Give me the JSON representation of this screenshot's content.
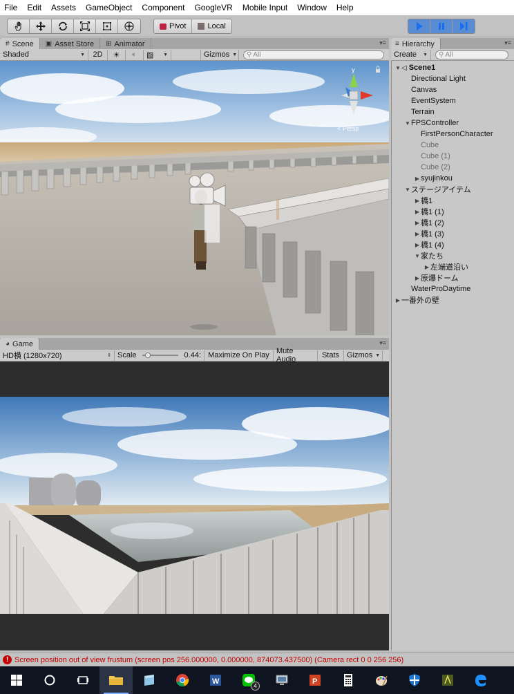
{
  "menu": [
    "File",
    "Edit",
    "Assets",
    "GameObject",
    "Component",
    "GoogleVR",
    "Mobile Input",
    "Window",
    "Help"
  ],
  "toolbar": {
    "pivot_label": "Pivot",
    "local_label": "Local"
  },
  "scene_tabs": {
    "scene": "Scene",
    "asset_store": "Asset Store",
    "animator": "Animator"
  },
  "scene_controls": {
    "shading": "Shaded",
    "mode_2d": "2D",
    "gizmos": "Gizmos",
    "search_placeholder": "All"
  },
  "gizmo": {
    "y_axis": "y",
    "view_label": "< Persp"
  },
  "hierarchy": {
    "tab": "Hierarchy",
    "create": "Create",
    "search_placeholder": "All",
    "items": [
      {
        "label": "Scene1",
        "tri": "▼",
        "indent": 0,
        "style": "bold"
      },
      {
        "label": "Directional Light",
        "tri": "",
        "indent": 1,
        "style": ""
      },
      {
        "label": "Canvas",
        "tri": "",
        "indent": 1,
        "style": ""
      },
      {
        "label": "EventSystem",
        "tri": "",
        "indent": 1,
        "style": ""
      },
      {
        "label": "Terrain",
        "tri": "",
        "indent": 1,
        "style": ""
      },
      {
        "label": "FPSController",
        "tri": "▼",
        "indent": 1,
        "style": ""
      },
      {
        "label": "FirstPersonCharacter",
        "tri": "",
        "indent": 2,
        "style": ""
      },
      {
        "label": "Cube",
        "tri": "",
        "indent": 2,
        "style": "dim"
      },
      {
        "label": "Cube (1)",
        "tri": "",
        "indent": 2,
        "style": "dim"
      },
      {
        "label": "Cube (2)",
        "tri": "",
        "indent": 2,
        "style": "dim"
      },
      {
        "label": "syujinkou",
        "tri": "▶",
        "indent": 2,
        "style": ""
      },
      {
        "label": "ステージアイテム",
        "tri": "▼",
        "indent": 1,
        "style": ""
      },
      {
        "label": "橋1",
        "tri": "▶",
        "indent": 2,
        "style": ""
      },
      {
        "label": "橋1 (1)",
        "tri": "▶",
        "indent": 2,
        "style": ""
      },
      {
        "label": "橋1 (2)",
        "tri": "▶",
        "indent": 2,
        "style": ""
      },
      {
        "label": "橋1 (3)",
        "tri": "▶",
        "indent": 2,
        "style": ""
      },
      {
        "label": "橋1 (4)",
        "tri": "▶",
        "indent": 2,
        "style": ""
      },
      {
        "label": "家たち",
        "tri": "▼",
        "indent": 2,
        "style": ""
      },
      {
        "label": "左端道沿い",
        "tri": "▶",
        "indent": 3,
        "style": ""
      },
      {
        "label": "原爆ドーム",
        "tri": "▶",
        "indent": 2,
        "style": ""
      },
      {
        "label": "WaterProDaytime",
        "tri": "",
        "indent": 1,
        "style": ""
      },
      {
        "label": "一番外の壁",
        "tri": "▶",
        "indent": 0,
        "style": ""
      }
    ]
  },
  "game_tab": {
    "title": "Game",
    "resolution": "HD横 (1280x720)",
    "scale_label": "Scale",
    "scale_value": "0.44:",
    "scale_fraction": 0.08,
    "maximize": "Maximize On Play",
    "mute": "Mute Audio",
    "stats": "Stats",
    "gizmos": "Gizmos"
  },
  "console": {
    "message": "Screen position out of view frustum (screen pos 256.000000, 0.000000, 874073.437500) (Camera rect 0 0 256 256)"
  },
  "taskbar": {
    "line_badge": "4",
    "icons": [
      "windows-start-icon",
      "cortana-search-icon",
      "task-view-icon",
      "file-explorer-icon",
      "notepad-icon",
      "chrome-icon",
      "word-icon",
      "line-icon",
      "remote-desktop-icon",
      "powerpoint-icon",
      "calculator-icon",
      "paint-icon",
      "windows-defender-icon",
      "app-icon",
      "edge-icon"
    ]
  },
  "colors": {
    "play_active": "#5a8cd4",
    "error_red": "#c40000",
    "sky_top": "#6a9fd1",
    "sand": "#cdb58f"
  }
}
